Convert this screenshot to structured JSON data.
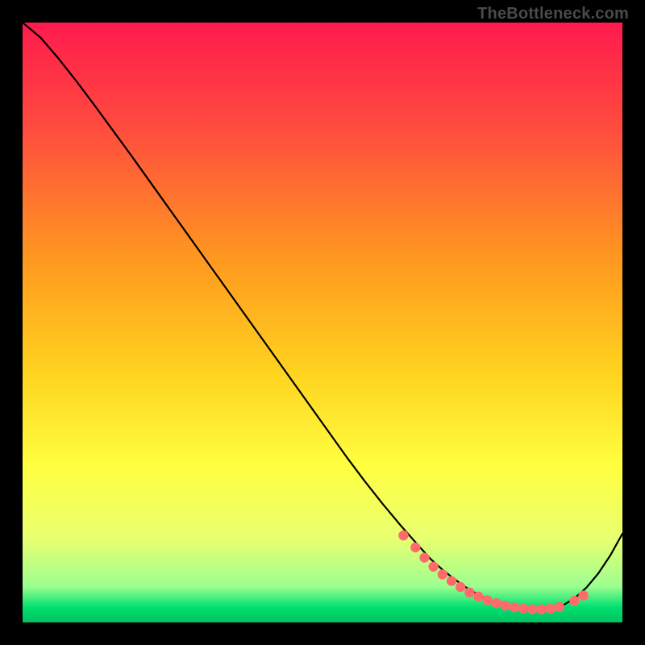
{
  "attribution": "TheBottleneck.com",
  "colors": {
    "background": "#000000",
    "grad_top": "#ff1a4d",
    "grad_mid": "#ffcc00",
    "grad_low": "#ffff80",
    "grad_bottom": "#00e070",
    "line": "#000000",
    "marker_fill": "#ff6b6b",
    "marker_stroke": "#d94e52"
  },
  "chart_data": {
    "type": "line",
    "title": "",
    "xlabel": "",
    "ylabel": "",
    "xlim": [
      0,
      100
    ],
    "ylim": [
      0,
      100
    ],
    "x": [
      0,
      3,
      6,
      9,
      12,
      15,
      18,
      21,
      24,
      27,
      30,
      33,
      36,
      39,
      42,
      45,
      48,
      51,
      54,
      57,
      60,
      63,
      66,
      68,
      70,
      72,
      74,
      76,
      78,
      80,
      82,
      84,
      86,
      88,
      90,
      92,
      94,
      96,
      98,
      100
    ],
    "values": [
      100,
      97.5,
      94,
      90.2,
      86.2,
      82.1,
      78,
      73.8,
      69.6,
      65.4,
      61.2,
      57,
      52.8,
      48.6,
      44.4,
      40.2,
      36,
      31.8,
      27.6,
      23.6,
      19.8,
      16.2,
      12.8,
      10.6,
      8.8,
      7.2,
      5.8,
      4.6,
      3.6,
      2.9,
      2.4,
      2.1,
      2.0,
      2.2,
      2.8,
      4.0,
      5.8,
      8.2,
      11.2,
      14.8
    ],
    "markers": {
      "x": [
        63.5,
        65.5,
        67,
        68.5,
        70,
        71.5,
        73,
        74.5,
        76,
        77.5,
        79,
        80.5,
        82,
        83.5,
        85,
        86.5,
        88,
        89.5,
        92,
        93.5
      ],
      "y": [
        14.5,
        12.5,
        10.8,
        9.3,
        8.0,
        6.9,
        5.9,
        5.0,
        4.3,
        3.7,
        3.2,
        2.8,
        2.5,
        2.3,
        2.2,
        2.2,
        2.3,
        2.6,
        3.6,
        4.5
      ]
    },
    "gradient_stops": [
      {
        "offset": 0.0,
        "color": "#ff1a4d"
      },
      {
        "offset": 0.18,
        "color": "#ff4d3e"
      },
      {
        "offset": 0.4,
        "color": "#ff9a1f"
      },
      {
        "offset": 0.58,
        "color": "#ffd21f"
      },
      {
        "offset": 0.74,
        "color": "#ffff40"
      },
      {
        "offset": 0.86,
        "color": "#e8ff70"
      },
      {
        "offset": 0.94,
        "color": "#9CFF90"
      },
      {
        "offset": 0.975,
        "color": "#00e070"
      },
      {
        "offset": 1.0,
        "color": "#00c060"
      }
    ]
  }
}
